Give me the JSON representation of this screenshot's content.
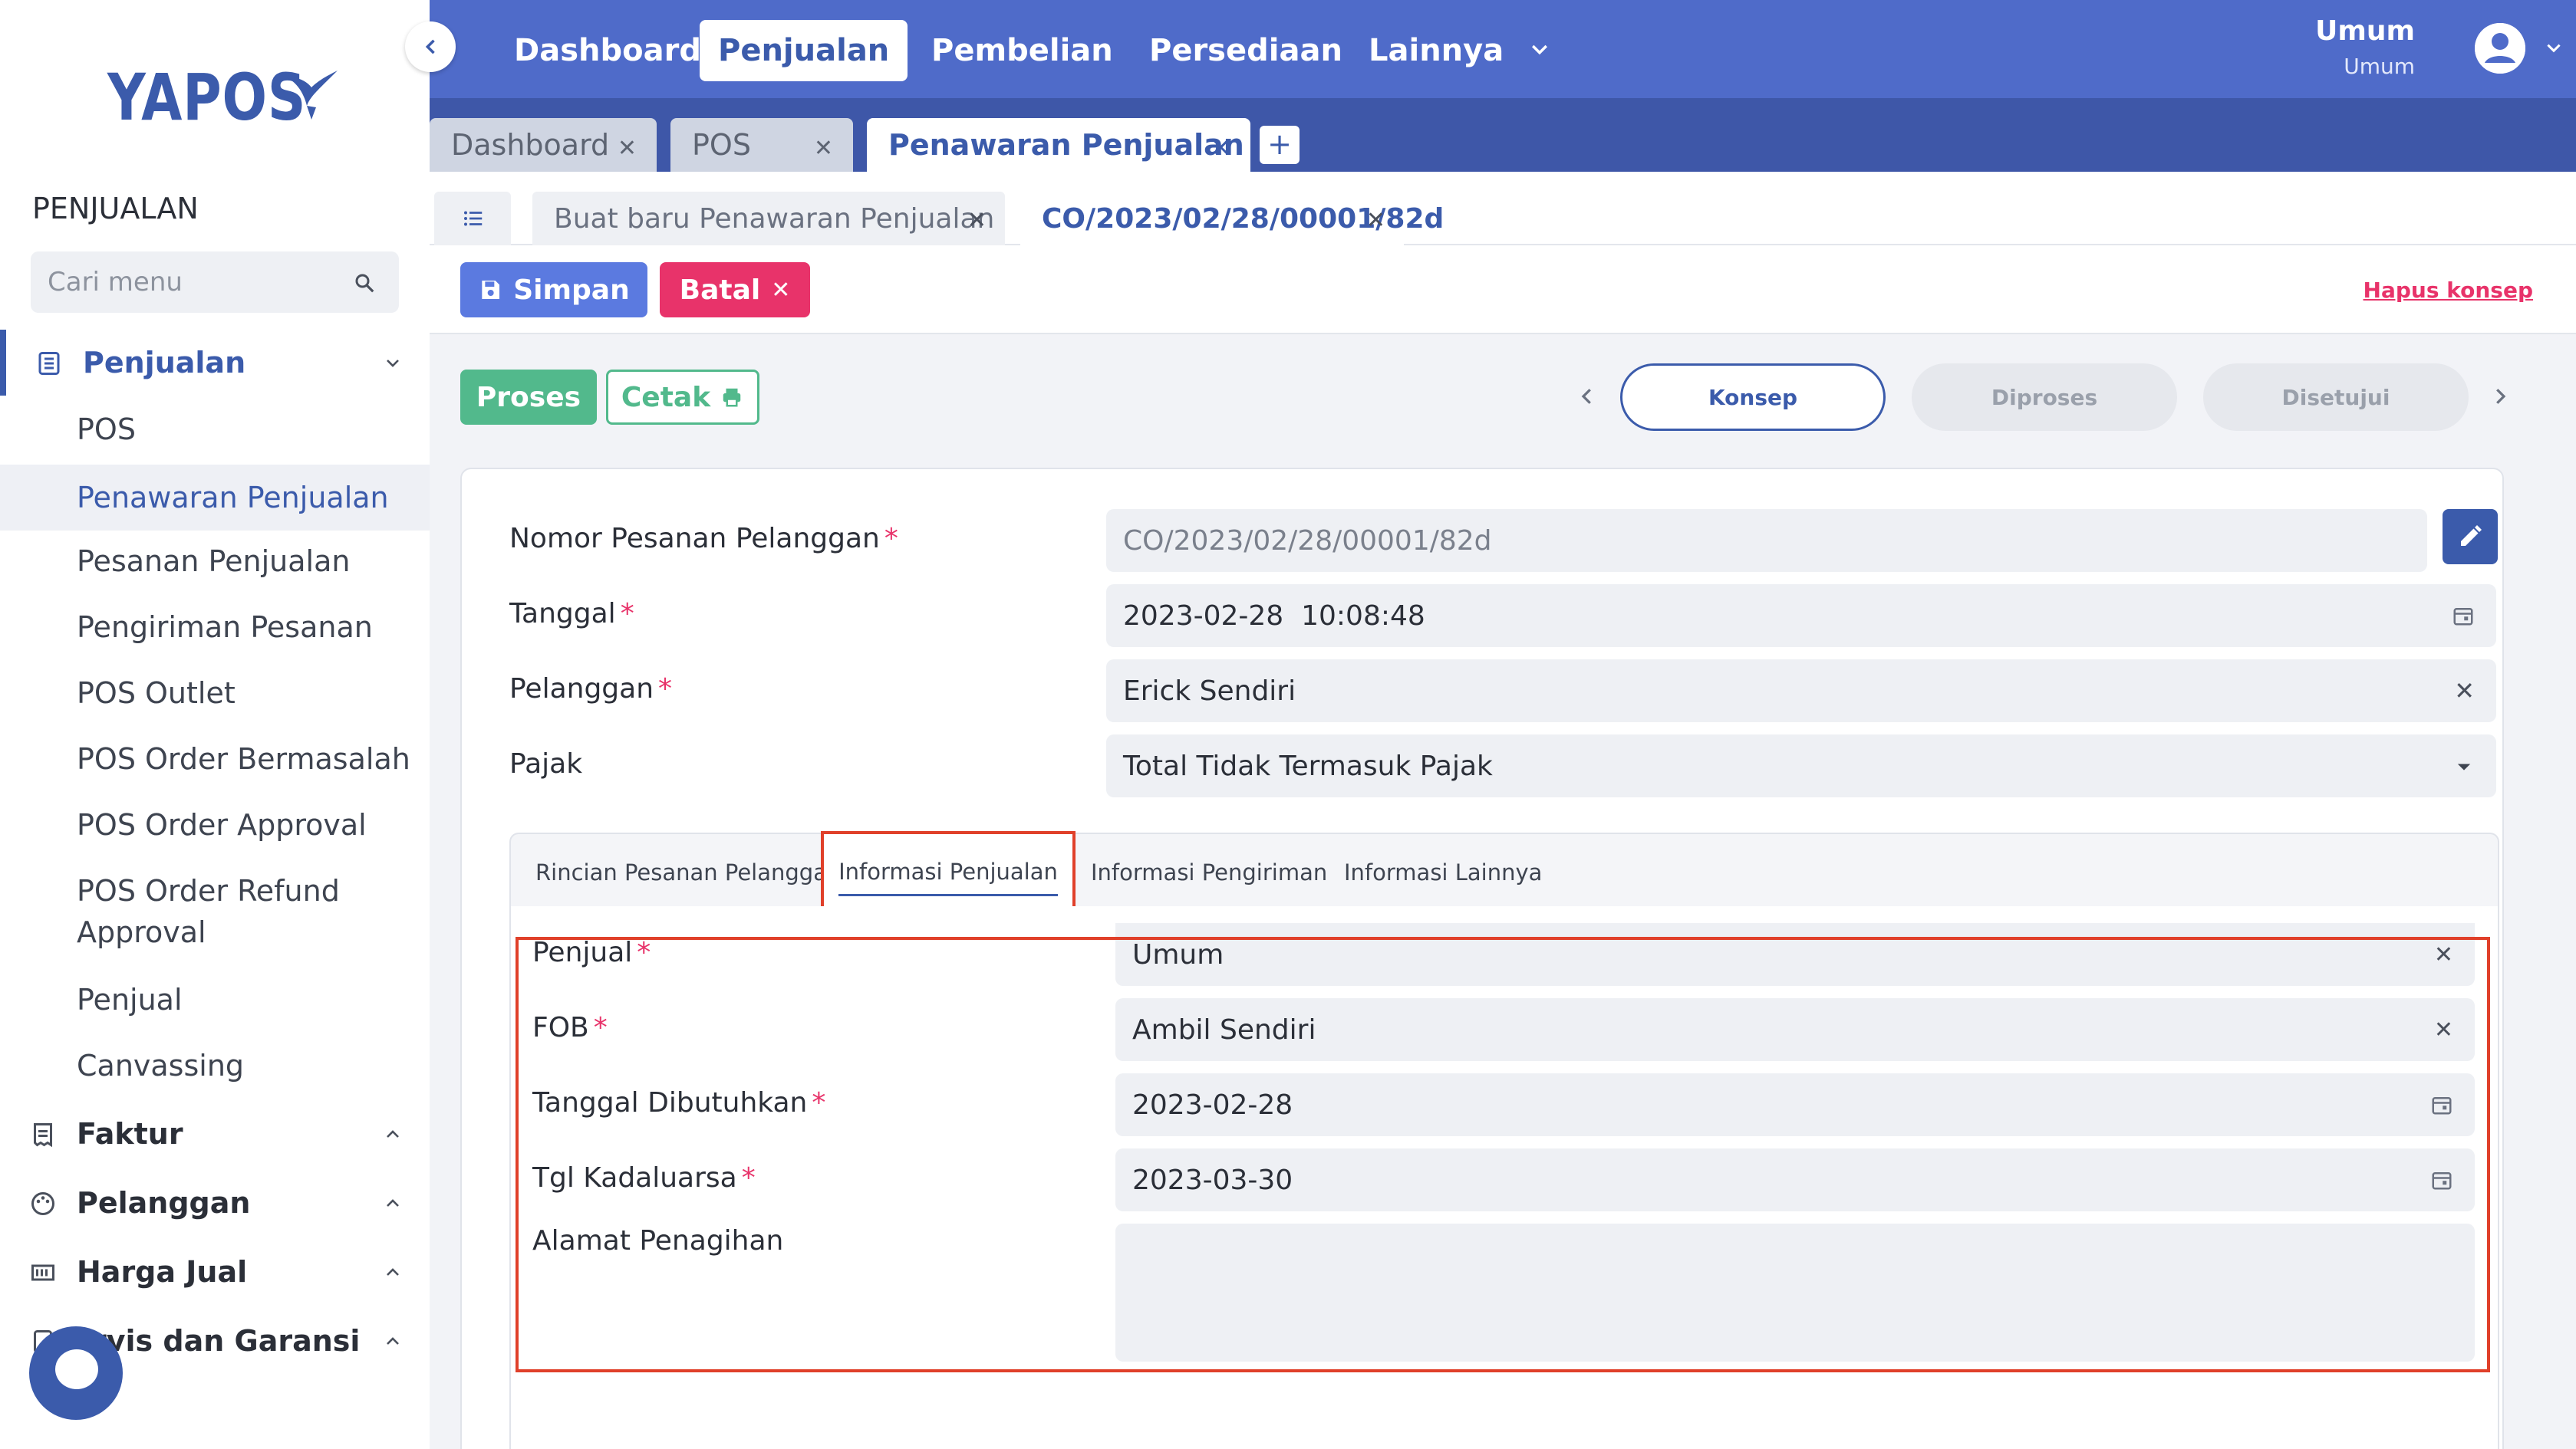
{
  "brand": {
    "name": "YAPOS"
  },
  "sidebar": {
    "section_title": "PENJUALAN",
    "search_placeholder": "Cari menu",
    "groups": [
      {
        "label": "Penjualan",
        "expanded": true,
        "items": [
          {
            "label": "POS"
          },
          {
            "label": "Penawaran Penjualan",
            "active": true
          },
          {
            "label": "Pesanan Penjualan"
          },
          {
            "label": "Pengiriman Pesanan"
          },
          {
            "label": "POS Outlet"
          },
          {
            "label": "POS Order Bermasalah"
          },
          {
            "label": "POS Order Approval"
          },
          {
            "label": "POS Order Refund"
          },
          {
            "label": "Approval"
          },
          {
            "label": "Penjual"
          },
          {
            "label": "Canvassing"
          }
        ]
      },
      {
        "label": "Faktur"
      },
      {
        "label": "Pelanggan"
      },
      {
        "label": "Harga Jual"
      },
      {
        "label": "rvis dan Garansi"
      }
    ]
  },
  "topnav": {
    "items": [
      "Dashboard",
      "Penjualan",
      "Pembelian",
      "Persediaan",
      "Lainnya"
    ],
    "active": "Penjualan",
    "user_name": "Umum",
    "user_role": "Umum"
  },
  "tabs": [
    "Dashboard",
    "POS",
    "Penawaran Penjualan"
  ],
  "tab_add_label": "+",
  "subtabs": [
    "Buat baru Penawaran Penjualan",
    "CO/2023/02/28/00001/82d"
  ],
  "actions": {
    "save": "Simpan",
    "cancel": "Batal",
    "delete_draft": "Hapus konsep",
    "process": "Proses",
    "print": "Cetak"
  },
  "steps": [
    "Konsep",
    "Diproses",
    "Disetujui"
  ],
  "form": {
    "order_number": {
      "label": "Nomor Pesanan Pelanggan",
      "value": "CO/2023/02/28/00001/82d"
    },
    "date": {
      "label": "Tanggal",
      "value": "2023-02-28  10:08:48"
    },
    "customer": {
      "label": "Pelanggan",
      "value": "Erick Sendiri"
    },
    "tax": {
      "label": "Pajak",
      "value": "Total Tidak Termasuk Pajak"
    },
    "required_mark": "*"
  },
  "inner_tabs": [
    "Rincian Pesanan Pelanggan",
    "Informasi Penjualan",
    "Informasi Pengiriman",
    "Informasi Lainnya"
  ],
  "sales_info": {
    "seller": {
      "label": "Penjual",
      "value": "Umum"
    },
    "fob": {
      "label": "FOB",
      "value": "Ambil Sendiri"
    },
    "needed_date": {
      "label": "Tanggal Dibutuhkan",
      "value": "2023-02-28"
    },
    "expiry_date": {
      "label": "Tgl Kadaluarsa",
      "value": "2023-03-30"
    },
    "billing_address": {
      "label": "Alamat Penagihan",
      "value": ""
    }
  },
  "colors": {
    "primary": "#3b5bab",
    "topbar": "#4f6bc9",
    "danger": "#e8336a",
    "success": "#52b98c",
    "highlight": "#e0402a"
  }
}
